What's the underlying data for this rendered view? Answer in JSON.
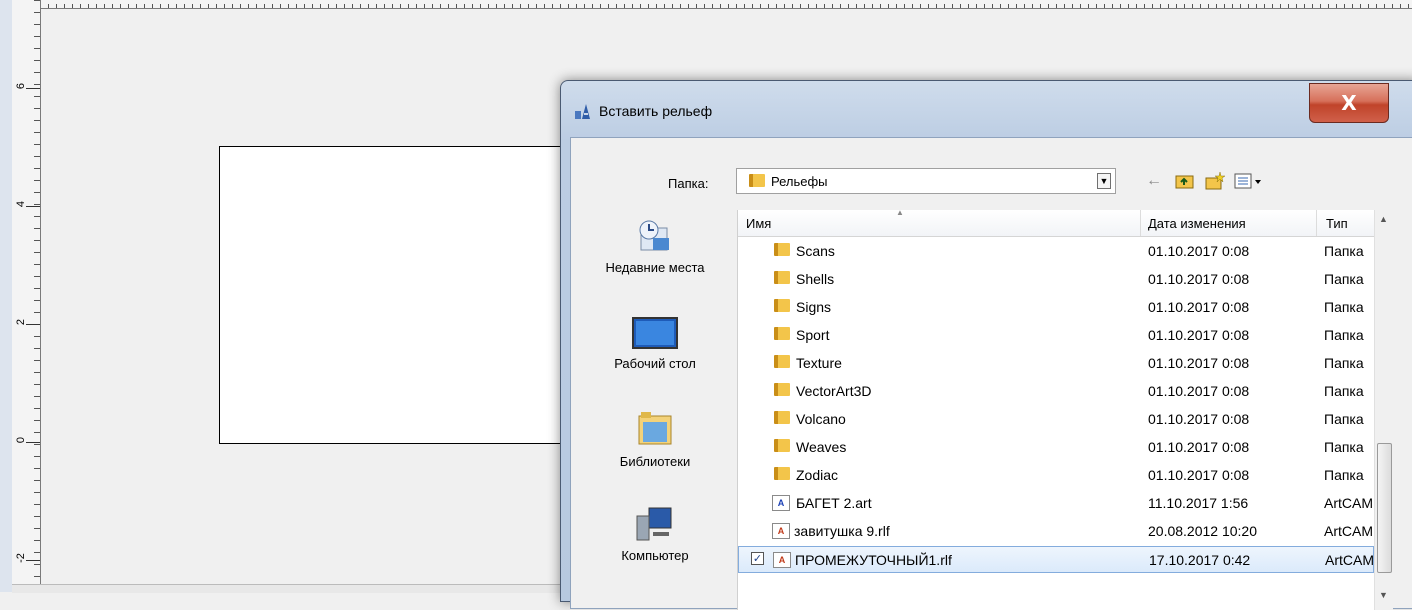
{
  "ruler": {
    "labels": [
      "6",
      "4",
      "2",
      "0",
      "-2"
    ]
  },
  "dialog": {
    "title": "Вставить рельеф",
    "close_label": "X",
    "folder_label": "Папка:",
    "folder_value": "Рельефы",
    "toolbar": {
      "back": "←",
      "up": "🗀",
      "new_folder": "✱",
      "view": "▦▾"
    },
    "places": [
      {
        "label": "Недавние места",
        "icon": "recent-places-icon"
      },
      {
        "label": "Рабочий стол",
        "icon": "desktop-icon"
      },
      {
        "label": "Библиотеки",
        "icon": "libraries-icon"
      },
      {
        "label": "Компьютер",
        "icon": "computer-icon"
      }
    ],
    "columns": {
      "name": "Имя",
      "date": "Дата изменения",
      "type": "Тип"
    },
    "files": [
      {
        "name": "Scans",
        "date": "01.10.2017 0:08",
        "type": "Папка",
        "kind": "folder"
      },
      {
        "name": "Shells",
        "date": "01.10.2017 0:08",
        "type": "Папка",
        "kind": "folder"
      },
      {
        "name": "Signs",
        "date": "01.10.2017 0:08",
        "type": "Папка",
        "kind": "folder"
      },
      {
        "name": "Sport",
        "date": "01.10.2017 0:08",
        "type": "Папка",
        "kind": "folder"
      },
      {
        "name": "Texture",
        "date": "01.10.2017 0:08",
        "type": "Папка",
        "kind": "folder"
      },
      {
        "name": "VectorArt3D",
        "date": "01.10.2017 0:08",
        "type": "Папка",
        "kind": "folder"
      },
      {
        "name": "Volcano",
        "date": "01.10.2017 0:08",
        "type": "Папка",
        "kind": "folder"
      },
      {
        "name": "Weaves",
        "date": "01.10.2017 0:08",
        "type": "Папка",
        "kind": "folder"
      },
      {
        "name": "Zodiac",
        "date": "01.10.2017 0:08",
        "type": "Папка",
        "kind": "folder"
      },
      {
        "name": "БАГЕТ 2.art",
        "date": "11.10.2017 1:56",
        "type": "ArtCAM",
        "kind": "art"
      },
      {
        "name": "завитушка 9.rlf",
        "date": "20.08.2012 10:20",
        "type": "ArtCAM",
        "kind": "rlf"
      },
      {
        "name": "ПРОМЕЖУТОЧНЫЙ1.rlf",
        "date": "17.10.2017 0:42",
        "type": "ArtCAM",
        "kind": "rlf",
        "selected": true
      }
    ]
  }
}
